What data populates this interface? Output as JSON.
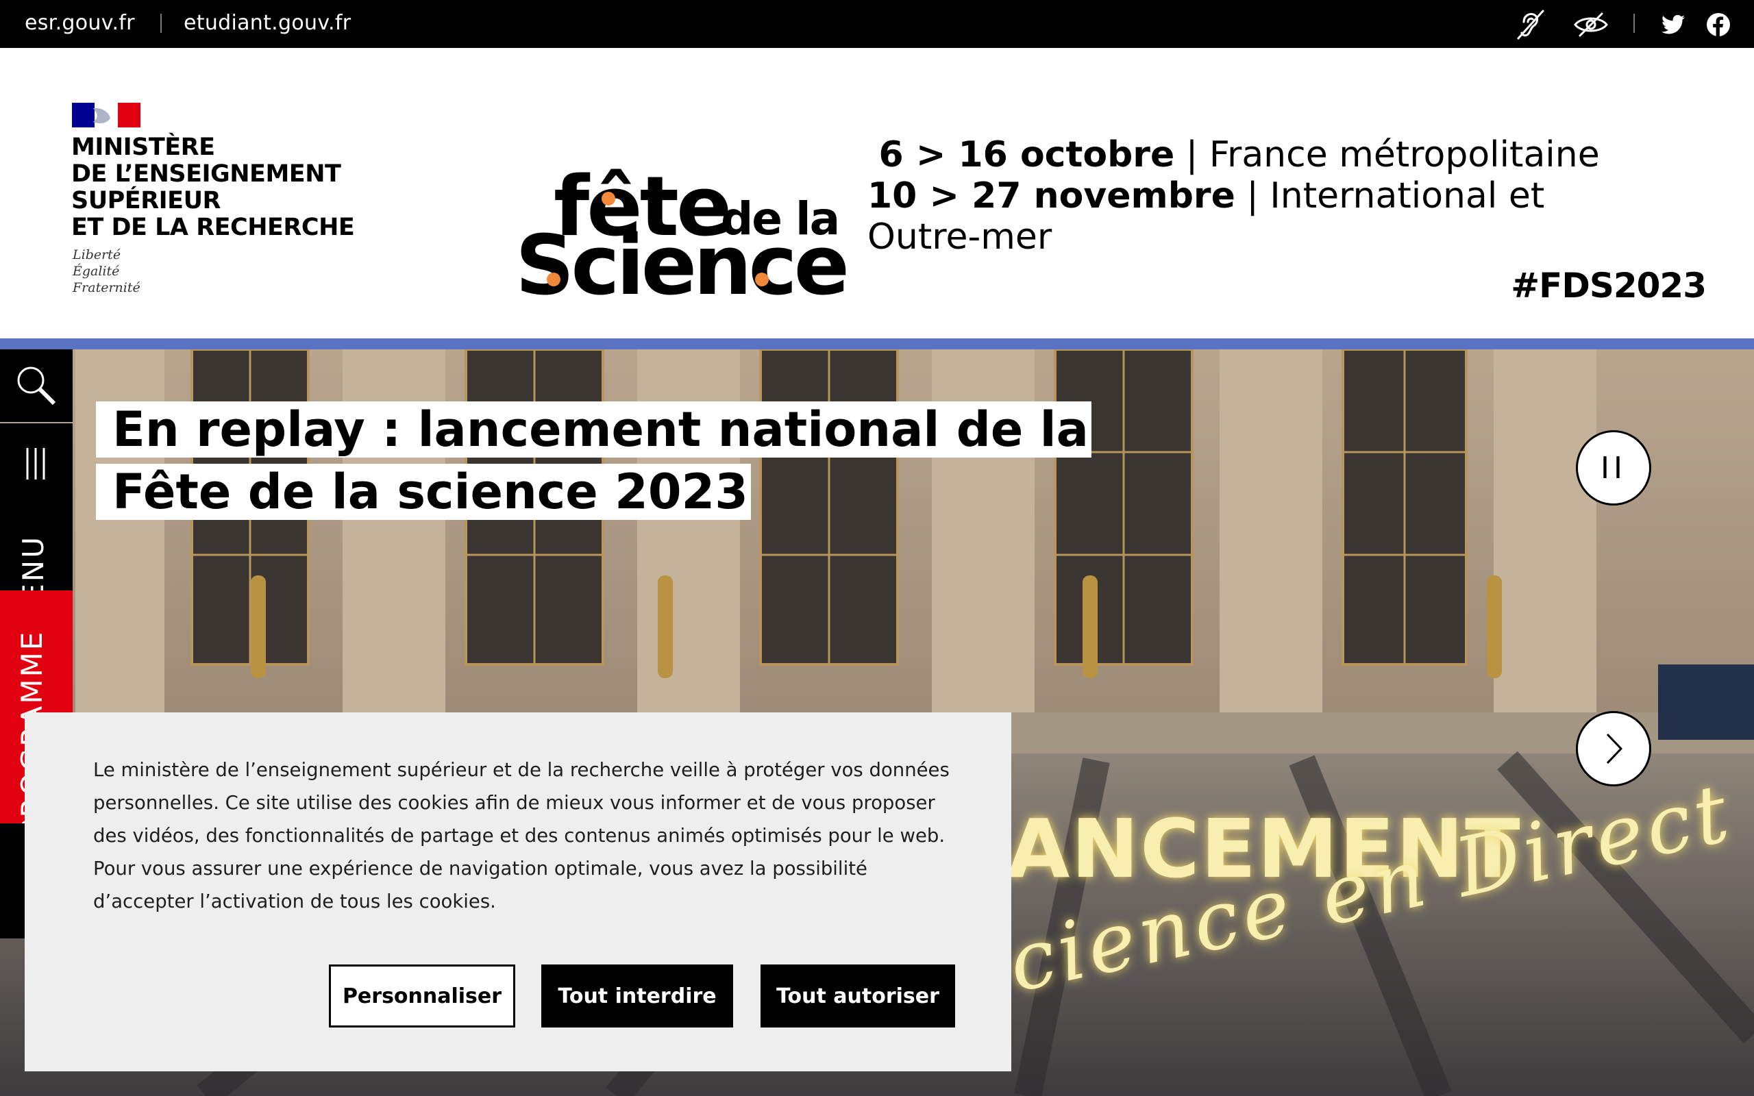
{
  "topbar": {
    "links": [
      "esr.gouv.fr",
      "etudiant.gouv.fr"
    ],
    "icons": [
      "hearing-impaired-icon",
      "visually-impaired-icon",
      "twitter-icon",
      "facebook-icon"
    ]
  },
  "header": {
    "ministry_lines": [
      "MINISTÈRE",
      "DE L’ENSEIGNEMENT",
      "SUPÉRIEUR",
      "ET DE LA RECHERCHE"
    ],
    "devise_lines": [
      "Liberté",
      "Égalité",
      "Fraternité"
    ],
    "logo": {
      "line1": "fête",
      "line2": "de la",
      "line3": "Science"
    },
    "dates": [
      {
        "bold": "6 > 16 octobre",
        "rest": " | France métropolitaine"
      },
      {
        "bold": "10 > 27 novembre",
        "rest": " | International et"
      },
      {
        "bold": "",
        "rest": "Outre-mer"
      }
    ],
    "hashtag": "#FDS2023"
  },
  "hero": {
    "title": "En replay : lancement national de la Fête de la science 2023",
    "image_text_1": "ANCEMENT",
    "image_text_2": "cience en Direct",
    "pause_label": "II"
  },
  "rail": {
    "menu_label": "MENU",
    "program_label": "PROGRAMME"
  },
  "cookie": {
    "lines": [
      "Le ministère de l’enseignement supérieur et de la recherche veille à protéger vos données",
      "personnelles. Ce site utilise des cookies afin de mieux vous informer et de vous proposer",
      "des vidéos, des fonctionnalités de partage et des contenus animés optimisés pour le web.",
      "Pour vous assurer une expérience de navigation optimale, vous avez la possibilité",
      "d’accepter l’activation de tous les cookies."
    ],
    "buttons": {
      "customize": "Personnaliser",
      "deny": "Tout interdire",
      "accept": "Tout autoriser"
    }
  },
  "colors": {
    "accent_blue": "#5a72c2",
    "program_red": "#e1000f",
    "logo_orange": "#f08a3a",
    "neon_yellow": "#f7eeb0"
  }
}
